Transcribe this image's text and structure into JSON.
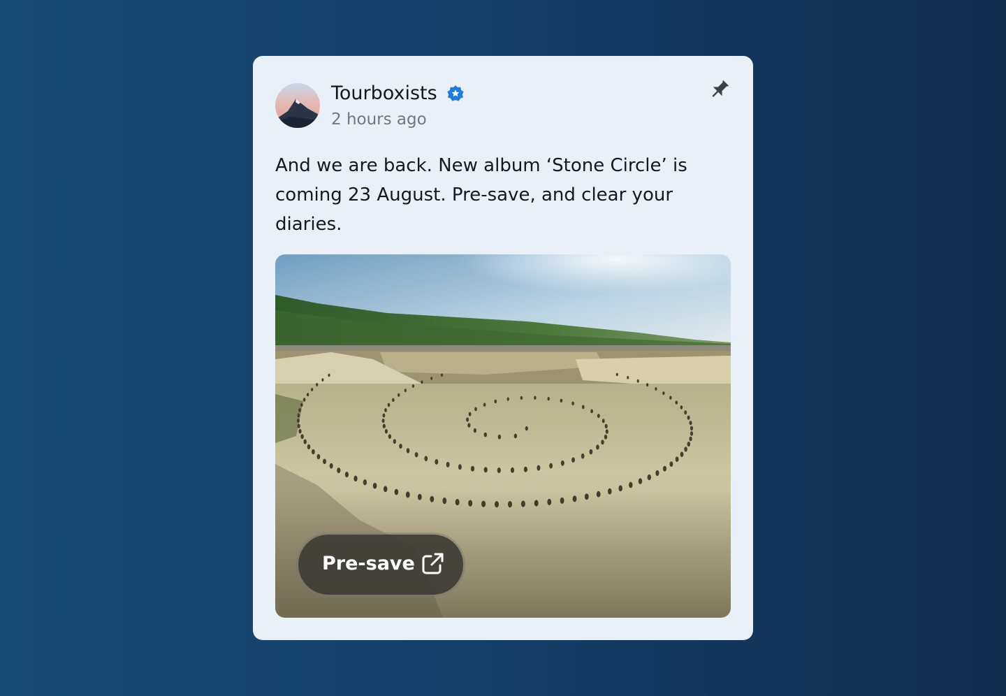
{
  "post": {
    "author": "Tourboxists",
    "verified_icon": "verified-badge-icon",
    "timestamp": "2 hours ago",
    "pin_icon": "pin-icon",
    "text_lines": [
      "And we are back. New album ‘Stone Circle’ is",
      "coming 23 August. Pre-save, and clear your",
      "diaries."
    ],
    "media": {
      "icon": "stone-spiral-photo",
      "cta_label": "Pre-save",
      "cta_icon": "external-link-icon"
    }
  },
  "colors": {
    "background_start": "#174a75",
    "background_end": "#0f2c4f",
    "card": "#eaf0f7",
    "verified_blue": "#1e7be0",
    "button_bg": "#3e3c36"
  }
}
